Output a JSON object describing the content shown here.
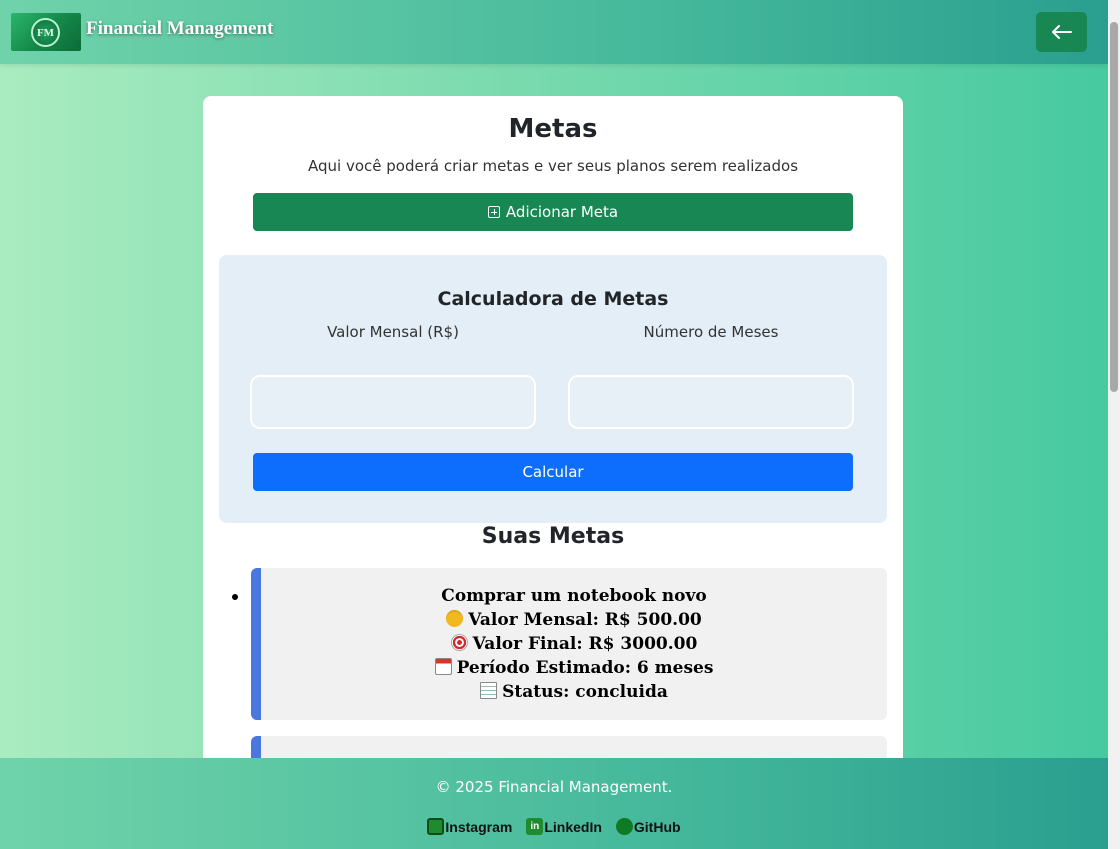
{
  "header": {
    "logo_text": "FM",
    "brand": "Financial Management",
    "back_icon": "arrow-left-icon"
  },
  "page": {
    "title": "Metas",
    "subtitle": "Aqui você poderá criar metas e ver seus planos serem realizados",
    "add_button": "Adicionar Meta"
  },
  "calculator": {
    "title": "Calculadora de Metas",
    "monthly_label": "Valor Mensal (R$)",
    "months_label": "Número de Meses",
    "monthly_value": "",
    "months_value": "",
    "button": "Calcular"
  },
  "goals": {
    "title": "Suas Metas",
    "items": [
      {
        "name": "Comprar um notebook novo",
        "monthly": "Valor Mensal: R$ 500.00",
        "final": "Valor Final: R$ 3000.00",
        "period": "Período Estimado: 6 meses",
        "status": "Status: concluida"
      }
    ]
  },
  "footer": {
    "copyright": "© 2025 Financial Management.",
    "links": [
      "Instagram",
      "LinkedIn",
      "GitHub"
    ]
  },
  "colors": {
    "primary_green": "#198754",
    "primary_blue": "#0d6efd",
    "goal_accent": "#4a78e0"
  }
}
